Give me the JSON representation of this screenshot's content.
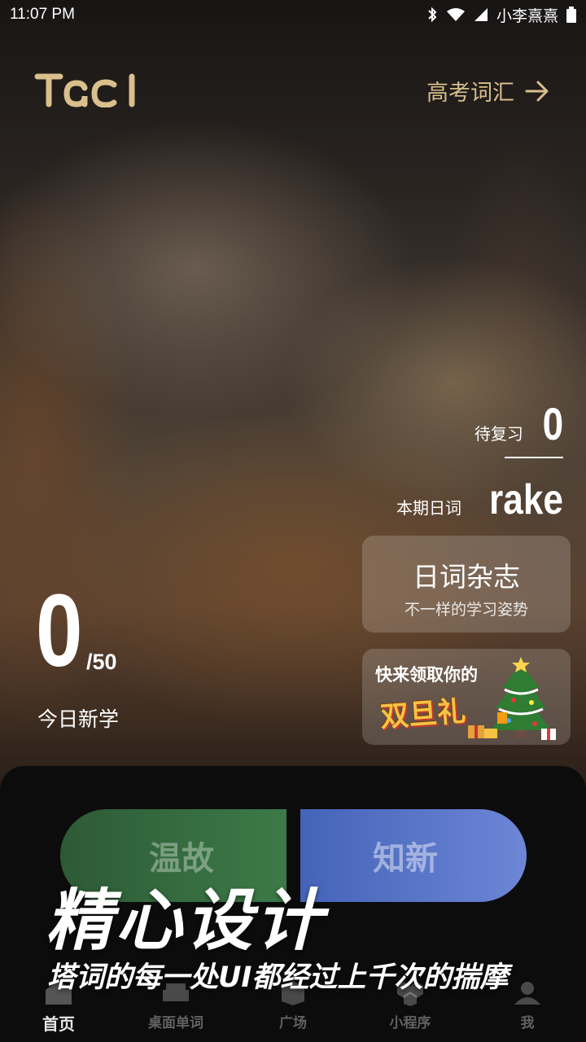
{
  "status_bar": {
    "time": "11:07  PM",
    "carrier": "小李熹熹",
    "icons": [
      "bluetooth-icon",
      "wifi-icon",
      "signal-icon",
      "battery-icon"
    ]
  },
  "header": {
    "logo_text": "TACI",
    "vocab_book_label": "高考词汇",
    "vocab_arrow_icon": "arrow-right-icon"
  },
  "stats": {
    "review_label": "待复习",
    "review_count": "0",
    "daily_word_label": "本期日词",
    "daily_word": "rake"
  },
  "cards": {
    "magazine_title": "日词杂志",
    "magazine_subtitle": "不一样的学习姿势",
    "gift_line1": "快来领取你的",
    "gift_line2": "双旦礼"
  },
  "today": {
    "count": "0",
    "total": "/50",
    "label": "今日新学"
  },
  "actions": {
    "review_button": "温故",
    "learn_button": "知新"
  },
  "tabs": [
    {
      "label": "首页",
      "icon": "home-icon",
      "active": true
    },
    {
      "label": "桌面单词",
      "icon": "sofa-icon",
      "active": false
    },
    {
      "label": "广场",
      "icon": "square-icon",
      "active": false
    },
    {
      "label": "小程序",
      "icon": "miniprogram-icon",
      "active": false
    },
    {
      "label": "我",
      "icon": "profile-icon",
      "active": false
    }
  ],
  "promo": {
    "title": "精心设计",
    "subtitle": "塔词的每一处UI都经过上千次的揣摩"
  },
  "colors": {
    "accent_gold": "#d9bf8c",
    "review_green": "#3c7a48",
    "learn_blue": "#6d86d6"
  }
}
